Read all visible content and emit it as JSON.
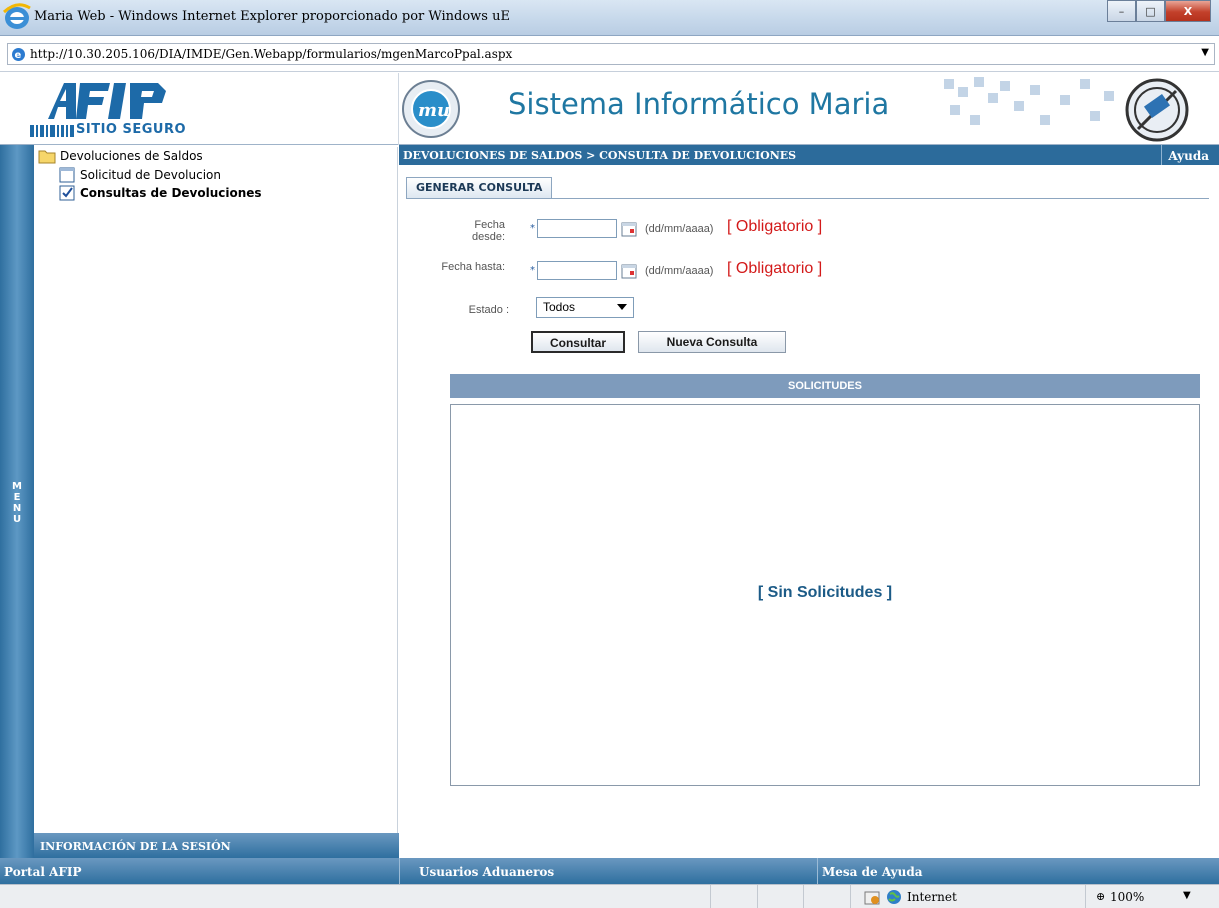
{
  "window": {
    "title": "Maria Web - Windows Internet Explorer proporcionado por Windows uE",
    "minimize": "–",
    "maximize": "□",
    "close": "X"
  },
  "address": {
    "url": "http://10.30.205.106/DIA/IMDE/Gen.Webapp/formularios/mgenMarcoPpal.aspx"
  },
  "header": {
    "afip_logo_text": "AFIP",
    "afip_sub": "SITIO SEGURO",
    "system_title": "Sistema Informático Maria"
  },
  "sidebar": {
    "menu_label": "MENU",
    "items": [
      {
        "label": "Devoluciones de Saldos",
        "icon": "folder-icon"
      },
      {
        "label": "Solicitud de Devolucion",
        "icon": "document-icon"
      },
      {
        "label": "Consultas de Devoluciones",
        "icon": "checked-document-icon"
      }
    ],
    "session_label": "INFORMACIÓN DE LA SESIÓN"
  },
  "content": {
    "breadcrumb": "DEVOLUCIONES DE SALDOS > CONSULTA DE DEVOLUCIONES",
    "help": "Ayuda",
    "tab": "GENERAR CONSULTA",
    "form": {
      "fecha_desde_label": "Fecha desde:",
      "fecha_hasta_label": "Fecha hasta:",
      "required_star": "*",
      "date_format": "(dd/mm/aaaa)",
      "required_text": "[ Obligatorio ]",
      "desde_value": "",
      "hasta_value": "",
      "estado_label": "Estado :",
      "estado_value": "Todos"
    },
    "buttons": {
      "consultar": "Consultar",
      "nueva": "Nueva Consulta"
    },
    "results": {
      "header": "SOLICITUDES",
      "empty": "[ Sin Solicitudes ]"
    }
  },
  "footer_links": {
    "portal": "Portal AFIP",
    "usuarios": "Usuarios Aduaneros",
    "mesa": "Mesa de Ayuda"
  },
  "status": {
    "zone": "Internet",
    "zoom": "100%"
  },
  "colors": {
    "accent_blue": "#2c6b9b",
    "title_blue": "#1f77a2",
    "required_red": "#d31a1a"
  }
}
